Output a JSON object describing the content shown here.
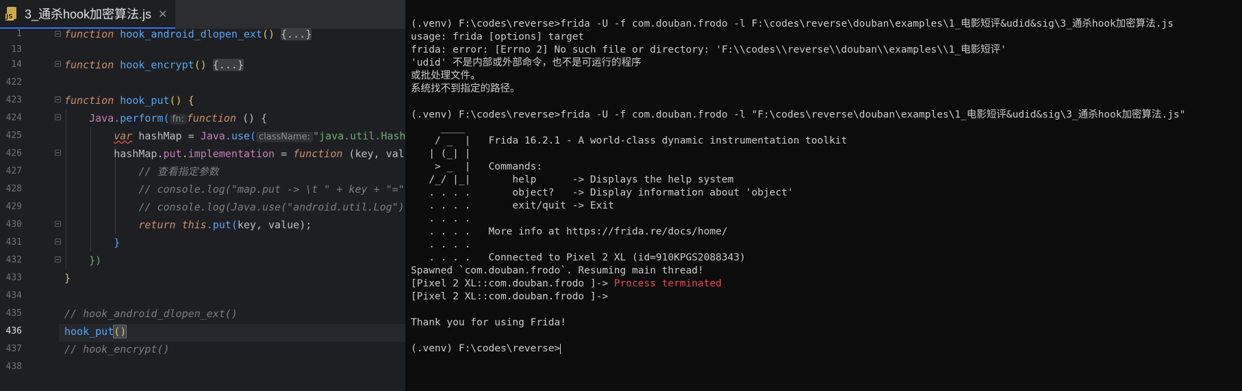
{
  "editor": {
    "tab": {
      "title": "3_通杀hook加密算法.js",
      "icon": "js-file-icon",
      "icon_label": "JS"
    },
    "line_numbers": [
      "1",
      "13",
      "14",
      "422",
      "423",
      "424",
      "425",
      "426",
      "427",
      "428",
      "429",
      "430",
      "431",
      "432",
      "433",
      "434",
      "435",
      "436",
      "437",
      "438"
    ],
    "current_line": "436",
    "code": {
      "l1_kw": "function",
      "l1_name": "hook_android_dlopen_ext",
      "l1_paren": "()",
      "l1_fold": "{...}",
      "l14_kw": "function",
      "l14_name": "hook_encrypt",
      "l14_paren": "()",
      "l14_fold": "{...}",
      "l423_kw": "function",
      "l423_name": "hook_put",
      "l423_tail": "() {",
      "l424_java": "Java",
      "l424_perform": ".perform(",
      "l424_hint": "fn:",
      "l424_kw": "function",
      "l424_tail": " () {",
      "l425_var": "var",
      "l425_mid": " hashMap = ",
      "l425_java": "Java",
      "l425_use": ".use(",
      "l425_hint": "className:",
      "l425_str": "\"java.util.HashMap\"",
      "l426_a": "hashMap.",
      "l426_put": "put",
      "l426_b": ".",
      "l426_impl": "implementation",
      "l426_c": " = ",
      "l426_kw": "function",
      "l426_d": " (key, value) {",
      "l427_cmt": "// 查看指定参数",
      "l428_cmt": "// console.log(\"map.put -> \\t \" + key + \"=\" + value)",
      "l429_cmt": "// console.log(Java.use(\"android.util.Log\").getStackTraceString(Java.use(\"java.lang.Throwable\").$new()))",
      "l430_kw": "return",
      "l430_this": "this",
      "l430_put": ".put(",
      "l430_args": "key, value",
      "l430_end": ");",
      "l431": "}",
      "l432": "})",
      "l433": "}",
      "l435_cmt": "// hook_android_dlopen_ext()",
      "l436_name": "hook_put",
      "l436_paren": "()",
      "l437_cmt": "// hook_encrypt()"
    }
  },
  "terminal": {
    "lines": [
      "(.venv) F:\\codes\\reverse>frida -U -f com.douban.frodo -l F:\\codes\\reverse\\douban\\examples\\1_电影短评&udid&sig\\3_通杀hook加密算法.js",
      "usage: frida [options] target",
      "frida: error: [Errno 2] No such file or directory: 'F:\\\\codes\\\\reverse\\\\douban\\\\examples\\\\1_电影短评'",
      "'udid' 不是内部或外部命令，也不是可运行的程序",
      "或批处理文件。",
      "系统找不到指定的路径。",
      "",
      "(.venv) F:\\codes\\reverse>frida -U -f com.douban.frodo -l \"F:\\codes\\reverse\\douban\\examples\\1_电影短评&udid&sig\\3_通杀hook加密算法.js\"",
      "     ____",
      "    / _  |   Frida 16.2.1 - A world-class dynamic instrumentation toolkit",
      "   | (_| |",
      "    > _  |   Commands:",
      "   /_/ |_|       help      -> Displays the help system",
      "   . . . .       object?   -> Display information about 'object'",
      "   . . . .       exit/quit -> Exit",
      "   . . . .",
      "   . . . .   More info at https://frida.re/docs/home/",
      "   . . . .",
      "   . . . .   Connected to Pixel 2 XL (id=910KPGS2088343)",
      "Spawned `com.douban.frodo`. Resuming main thread!"
    ],
    "prompt1": "[Pixel 2 XL::com.douban.frodo ]-> ",
    "terminated": "Process terminated",
    "prompt2": "[Pixel 2 XL::com.douban.frodo ]->",
    "thanks": "Thank you for using Frida!",
    "final_prompt": "(.venv) F:\\codes\\reverse>",
    "colors": {
      "error": "#e74856",
      "text": "#cccccc",
      "background": "#0c0c0c"
    }
  }
}
